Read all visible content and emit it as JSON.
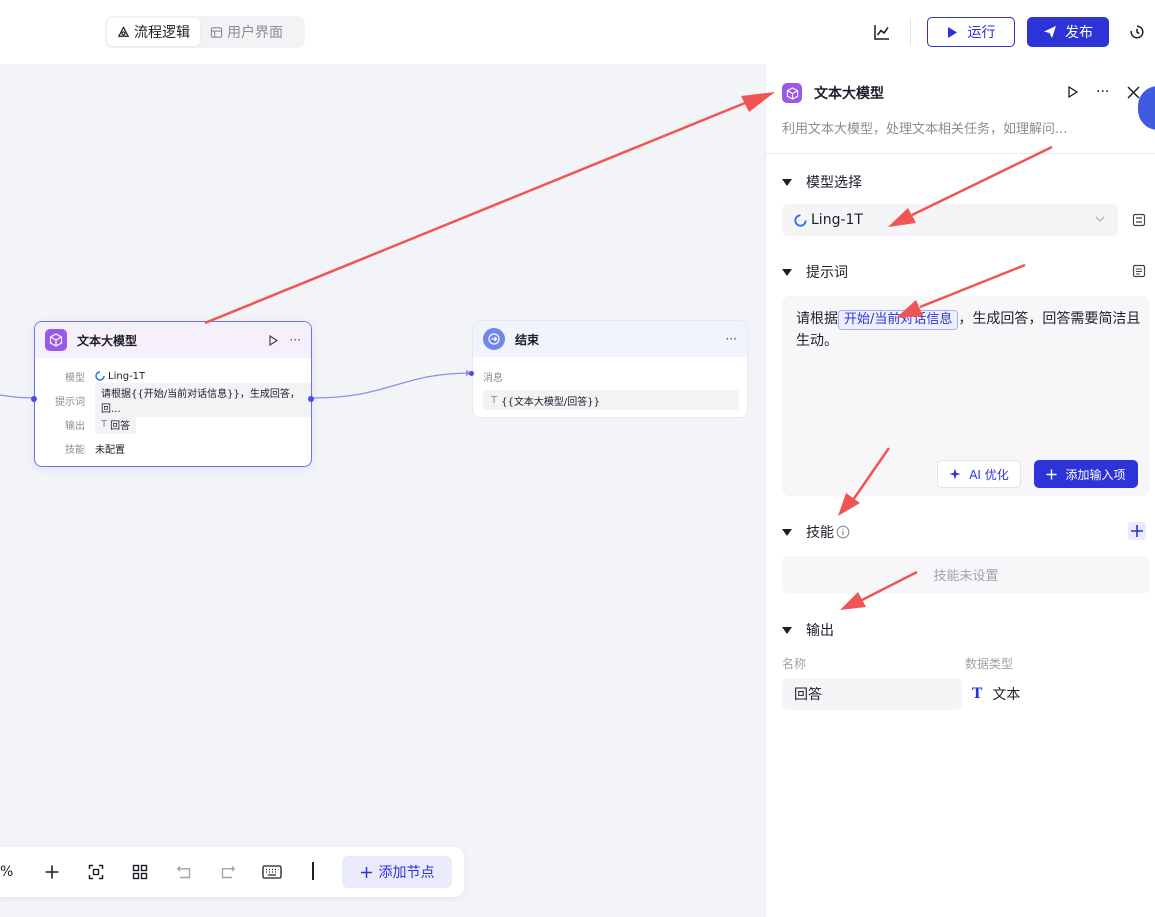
{
  "header": {
    "tabs": [
      {
        "label": "流程逻辑",
        "active": true,
        "icon": "flow-icon"
      },
      {
        "label": "用户界面",
        "active": false,
        "icon": "layout-icon"
      }
    ],
    "run_label": "运行",
    "publish_label": "发布",
    "accent_color": "#2d33d6"
  },
  "canvas": {
    "llm_node": {
      "title": "文本大模型",
      "rows": [
        {
          "label": "模型",
          "value": "Ling-1T"
        },
        {
          "label": "提示词",
          "value": "请根据{{开始/当前对话信息}}，生成回答，回..."
        },
        {
          "label": "输出",
          "value": "回答"
        },
        {
          "label": "技能",
          "value": "未配置"
        }
      ]
    },
    "end_node": {
      "title": "结束",
      "message_label": "消息",
      "message_value": "{{文本大模型/回答}}"
    }
  },
  "toolbar": {
    "zoom": "%",
    "add_node_label": "添加节点"
  },
  "panel": {
    "title": "文本大模型",
    "description": "利用文本大模型，处理文本相关任务，如理解问...",
    "model_section": {
      "title": "模型选择",
      "selected": "Ling-1T"
    },
    "prompt_section": {
      "title": "提示词",
      "text_before": "请根据",
      "variable": "开始/当前对话信息",
      "text_after": "，生成回答，回答需要简洁且生动。",
      "ai_optimize_label": "AI 优化",
      "add_input_label": "添加输入项"
    },
    "skills_section": {
      "title": "技能",
      "empty_text": "技能未设置"
    },
    "output_section": {
      "title": "输出",
      "col_name": "名称",
      "col_type": "数据类型",
      "row_name": "回答",
      "row_type": "文本"
    }
  }
}
